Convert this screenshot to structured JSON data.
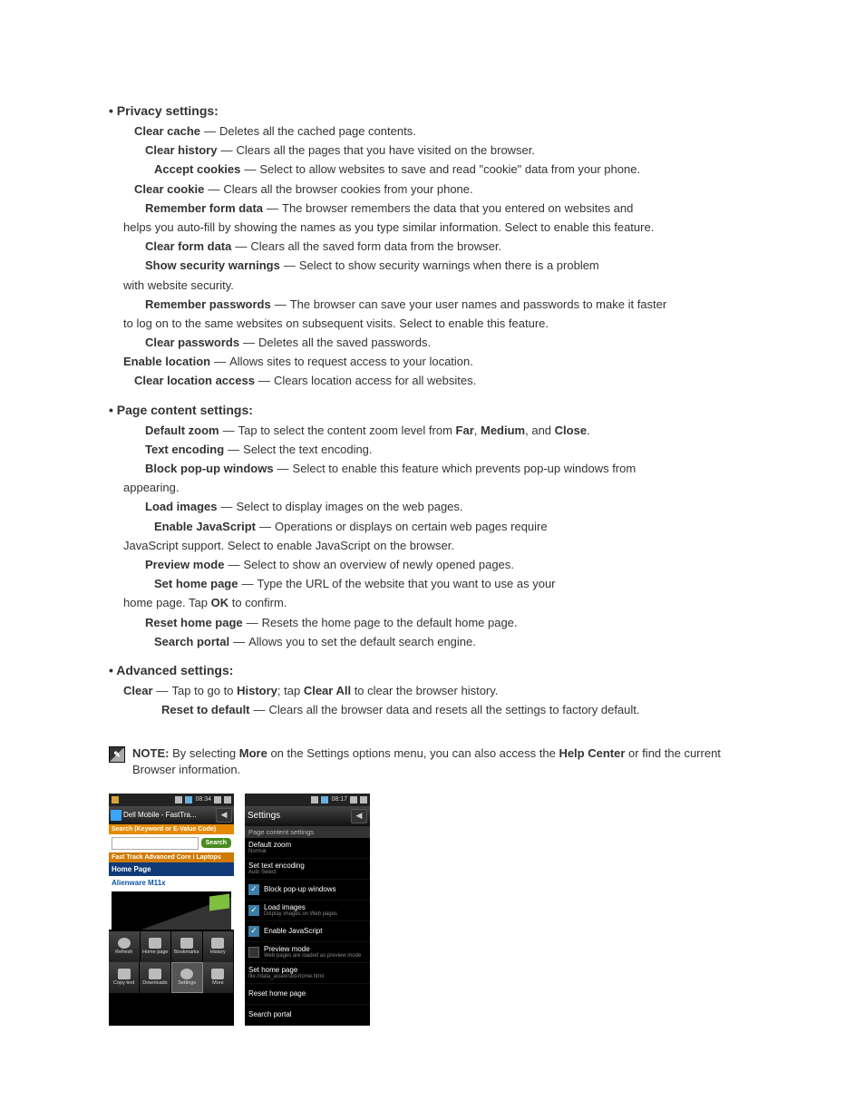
{
  "section_privacy": {
    "title": "• Privacy settings:",
    "items": [
      {
        "label": "Clear cache",
        "desc": "Deletes all the cached page contents.",
        "indent": 2
      },
      {
        "label": "Clear history",
        "desc": "Clears all the pages that you have visited on the browser.",
        "indent": 3
      },
      {
        "label": "Accept cookies",
        "desc": "Select to allow websites to save and read \"cookie\" data from your phone.",
        "indent": 4
      },
      {
        "label": "Clear cookie",
        "desc": "Clears all the browser cookies from your phone.",
        "indent": 2
      },
      {
        "label": "Remember form data",
        "desc": "The browser remembers the data that you entered on websites and",
        "indent": 3,
        "cont": "helps you auto-fill by showing the names as you type similar information. Select to enable this feature."
      },
      {
        "label": "Clear form data",
        "desc": "Clears all the saved form data from the browser.",
        "indent": 3
      },
      {
        "label": "Show security warnings",
        "desc": "Select to show security warnings when there is a problem",
        "indent": 3,
        "cont": "with website security."
      },
      {
        "label": "Remember passwords",
        "desc": "The browser can save your user names and passwords to make it faster",
        "indent": 3,
        "cont": "to log on to the same websites on subsequent visits. Select to enable this feature."
      },
      {
        "label": "Clear passwords",
        "desc": "Deletes all the saved passwords.",
        "indent": 3
      },
      {
        "label": "Enable location",
        "desc": "Allows sites to request access to your location.",
        "indent": 1
      },
      {
        "label": "Clear location access",
        "desc": "Clears location access for all websites.",
        "indent": 2
      }
    ]
  },
  "section_page": {
    "title": "• Page content settings:",
    "items": [
      {
        "label": "Default zoom",
        "desc": "Tap to select the content zoom level from Far, Medium, and Close.",
        "indent": 3
      },
      {
        "label": "Text encoding",
        "desc": "Select the text encoding.",
        "indent": 3
      },
      {
        "label": "Block pop-up windows",
        "desc": "Select to enable this feature which prevents pop-up windows from",
        "indent": 3,
        "cont": "appearing."
      },
      {
        "label": "Load images",
        "desc": "Select to display images on the web pages.",
        "indent": 3
      },
      {
        "label": "Enable JavaScript",
        "desc": "Operations or displays on certain web pages require",
        "indent": 4,
        "cont": "JavaScript support. Select to enable JavaScript on the browser."
      },
      {
        "label": "Preview mode",
        "desc": "Select to show an overview of newly opened pages.",
        "indent": 3
      },
      {
        "label": "Set home page",
        "desc": "Type the URL of the website that you want to use as your",
        "indent": 4,
        "cont": "home page. Tap OK to confirm."
      },
      {
        "label": "Reset home page",
        "desc": "Resets the home page to the default home page.",
        "indent": 3
      },
      {
        "label": "Search portal",
        "desc": "Allows you to set the default search engine.",
        "indent": 4
      }
    ]
  },
  "section_advanced": {
    "title": "• Advanced settings:",
    "items": [
      {
        "label": "Clear",
        "desc": "Tap to go to History; tap Clear All to clear the browser history.",
        "indent": 1
      },
      {
        "label": "Reset to default",
        "desc": "Clears all the browser data and resets all the settings to factory default.",
        "indent": 5
      }
    ]
  },
  "note": {
    "label": "NOTE:",
    "text": "By selecting More on the Settings options menu, you can also access the Help Center or find the current Browser information."
  },
  "phone1": {
    "status_time": "08:34",
    "addr_title": "Dell Mobile - FastTra...",
    "orange_text": "Search (Keyword or E-Value Code)",
    "search_btn": "Search",
    "blue_text": "Fast Track Advanced Core i Laptops",
    "homepage": "Home Page",
    "product": "Alienware M11x",
    "menu1": [
      "Refresh",
      "Home page",
      "Bookmarks",
      "History"
    ],
    "menu2": [
      "Copy text",
      "Downloads",
      "Settings",
      "More"
    ]
  },
  "phone2": {
    "status_time": "08:17",
    "title": "Settings",
    "section": "Page content settings",
    "rows": [
      {
        "t": "Default zoom",
        "s": "Normal",
        "chk": null
      },
      {
        "t": "Set text encoding",
        "s": "Auto Select",
        "chk": null
      },
      {
        "t": "Block pop-up windows",
        "s": "",
        "chk": true
      },
      {
        "t": "Load images",
        "s": "Display images on Web pages",
        "chk": true
      },
      {
        "t": "Enable JavaScript",
        "s": "",
        "chk": true
      },
      {
        "t": "Preview mode",
        "s": "Web pages are loaded as preview mode",
        "chk": false
      },
      {
        "t": "Set home page",
        "s": "file://data_asset/stid-home.html",
        "chk": null
      },
      {
        "t": "Reset home page",
        "s": "",
        "chk": null
      },
      {
        "t": "Search portal",
        "s": "",
        "chk": null
      }
    ]
  }
}
